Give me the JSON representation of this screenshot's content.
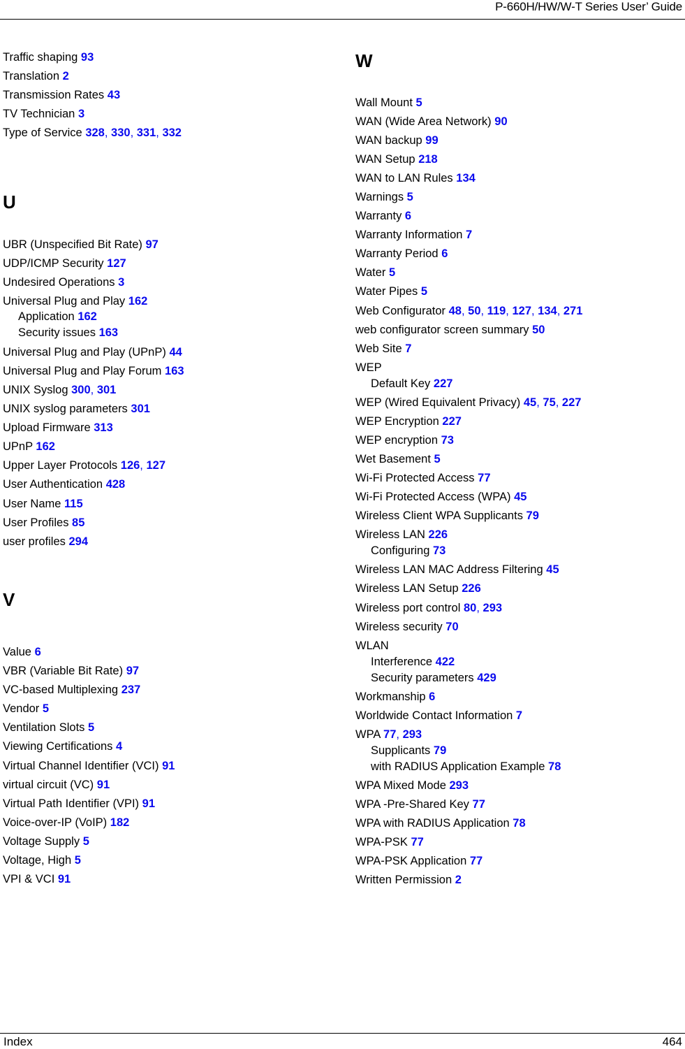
{
  "header": {
    "title": "P-660H/HW/W-T Series User’ Guide"
  },
  "footer": {
    "section": "Index",
    "page_number": "464"
  },
  "left_column": [
    {
      "type": "entry",
      "term": "Traffic shaping",
      "pages": [
        "93"
      ]
    },
    {
      "type": "entry",
      "term": "Translation",
      "pages": [
        "2"
      ]
    },
    {
      "type": "entry",
      "term": "Transmission Rates",
      "pages": [
        "43"
      ]
    },
    {
      "type": "entry",
      "term": "TV Technician",
      "pages": [
        "3"
      ]
    },
    {
      "type": "entry",
      "term": "Type of Service",
      "pages": [
        "328",
        "330",
        "331",
        "332"
      ]
    },
    {
      "type": "letter",
      "term": "U"
    },
    {
      "type": "entry",
      "term": "UBR (Unspecified Bit Rate)",
      "pages": [
        "97"
      ]
    },
    {
      "type": "entry",
      "term": "UDP/ICMP Security",
      "pages": [
        "127"
      ]
    },
    {
      "type": "entry",
      "term": "Undesired Operations",
      "pages": [
        "3"
      ]
    },
    {
      "type": "entry",
      "term": "Universal Plug and Play",
      "pages": [
        "162"
      ]
    },
    {
      "type": "sub",
      "term": "Application",
      "pages": [
        "162"
      ]
    },
    {
      "type": "sub",
      "term": "Security issues",
      "pages": [
        "163"
      ]
    },
    {
      "type": "entry",
      "term": "Universal Plug and Play (UPnP)",
      "pages": [
        "44"
      ]
    },
    {
      "type": "entry",
      "term": "Universal Plug and Play Forum",
      "pages": [
        "163"
      ]
    },
    {
      "type": "entry",
      "term": "UNIX Syslog",
      "pages": [
        "300",
        "301"
      ]
    },
    {
      "type": "entry",
      "term": "UNIX syslog parameters",
      "pages": [
        "301"
      ]
    },
    {
      "type": "entry",
      "term": "Upload Firmware",
      "pages": [
        "313"
      ]
    },
    {
      "type": "entry",
      "term": "UPnP",
      "pages": [
        "162"
      ]
    },
    {
      "type": "entry",
      "term": "Upper Layer Protocols",
      "pages": [
        "126",
        "127"
      ]
    },
    {
      "type": "entry",
      "term": "User Authentication",
      "pages": [
        "428"
      ]
    },
    {
      "type": "entry",
      "term": "User Name",
      "pages": [
        "115"
      ]
    },
    {
      "type": "entry",
      "term": "User Profiles",
      "pages": [
        "85"
      ]
    },
    {
      "type": "entry",
      "term": "user profiles",
      "pages": [
        "294"
      ]
    },
    {
      "type": "letter",
      "term": "V"
    },
    {
      "type": "entry",
      "term": "Value",
      "pages": [
        "6"
      ]
    },
    {
      "type": "entry",
      "term": "VBR (Variable Bit Rate)",
      "pages": [
        "97"
      ]
    },
    {
      "type": "entry",
      "term": "VC-based Multiplexing",
      "pages": [
        "237"
      ]
    },
    {
      "type": "entry",
      "term": "Vendor",
      "pages": [
        "5"
      ]
    },
    {
      "type": "entry",
      "term": "Ventilation Slots",
      "pages": [
        "5"
      ]
    },
    {
      "type": "entry",
      "term": "Viewing Certifications",
      "pages": [
        "4"
      ]
    },
    {
      "type": "entry",
      "term": "Virtual Channel Identifier (VCI)",
      "pages": [
        "91"
      ]
    },
    {
      "type": "entry",
      "term": "virtual circuit (VC)",
      "pages": [
        "91"
      ]
    },
    {
      "type": "entry",
      "term": "Virtual Path Identifier (VPI)",
      "pages": [
        "91"
      ]
    },
    {
      "type": "entry",
      "term": "Voice-over-IP (VoIP)",
      "pages": [
        "182"
      ]
    },
    {
      "type": "entry",
      "term": "Voltage Supply",
      "pages": [
        "5"
      ]
    },
    {
      "type": "entry",
      "term": "Voltage, High",
      "pages": [
        "5"
      ]
    },
    {
      "type": "entry",
      "term": "VPI & VCI",
      "pages": [
        "91"
      ]
    }
  ],
  "right_column": [
    {
      "type": "letter",
      "term": "W"
    },
    {
      "type": "entry",
      "term": "Wall Mount",
      "pages": [
        "5"
      ]
    },
    {
      "type": "entry",
      "term": "WAN (Wide Area Network)",
      "pages": [
        "90"
      ]
    },
    {
      "type": "entry",
      "term": "WAN backup",
      "pages": [
        "99"
      ]
    },
    {
      "type": "entry",
      "term": "WAN Setup",
      "pages": [
        "218"
      ]
    },
    {
      "type": "entry",
      "term": "WAN to LAN Rules",
      "pages": [
        "134"
      ]
    },
    {
      "type": "entry",
      "term": "Warnings",
      "pages": [
        "5"
      ]
    },
    {
      "type": "entry",
      "term": "Warranty",
      "pages": [
        "6"
      ]
    },
    {
      "type": "entry",
      "term": "Warranty Information",
      "pages": [
        "7"
      ]
    },
    {
      "type": "entry",
      "term": "Warranty Period",
      "pages": [
        "6"
      ]
    },
    {
      "type": "entry",
      "term": "Water",
      "pages": [
        "5"
      ]
    },
    {
      "type": "entry",
      "term": "Water Pipes",
      "pages": [
        "5"
      ]
    },
    {
      "type": "entry",
      "term": "Web Configurator",
      "pages": [
        "48",
        "50",
        "119",
        "127",
        "134",
        "271"
      ]
    },
    {
      "type": "entry",
      "term": "web configurator screen summary",
      "pages": [
        "50"
      ]
    },
    {
      "type": "entry",
      "term": "Web Site",
      "pages": [
        "7"
      ]
    },
    {
      "type": "entry",
      "term": "WEP",
      "pages": []
    },
    {
      "type": "sub",
      "term": "Default Key",
      "pages": [
        "227"
      ]
    },
    {
      "type": "entry",
      "term": "WEP (Wired Equivalent Privacy)",
      "pages": [
        "45",
        "75",
        "227"
      ]
    },
    {
      "type": "entry",
      "term": "WEP Encryption",
      "pages": [
        "227"
      ]
    },
    {
      "type": "entry",
      "term": "WEP encryption",
      "pages": [
        "73"
      ]
    },
    {
      "type": "entry",
      "term": "Wet Basement",
      "pages": [
        "5"
      ]
    },
    {
      "type": "entry",
      "term": "Wi-Fi Protected Access",
      "pages": [
        "77"
      ]
    },
    {
      "type": "entry",
      "term": "Wi-Fi Protected Access (WPA)",
      "pages": [
        "45"
      ]
    },
    {
      "type": "entry",
      "term": "Wireless Client WPA Supplicants",
      "pages": [
        "79"
      ]
    },
    {
      "type": "entry",
      "term": "Wireless LAN",
      "pages": [
        "226"
      ]
    },
    {
      "type": "sub",
      "term": "Configuring",
      "pages": [
        "73"
      ]
    },
    {
      "type": "entry",
      "term": "Wireless LAN MAC Address Filtering",
      "pages": [
        "45"
      ]
    },
    {
      "type": "entry",
      "term": "Wireless LAN Setup",
      "pages": [
        "226"
      ]
    },
    {
      "type": "entry",
      "term": "Wireless port control",
      "pages": [
        "80",
        "293"
      ]
    },
    {
      "type": "entry",
      "term": "Wireless security",
      "pages": [
        "70"
      ]
    },
    {
      "type": "entry",
      "term": "WLAN",
      "pages": []
    },
    {
      "type": "sub",
      "term": "Interference",
      "pages": [
        "422"
      ]
    },
    {
      "type": "sub",
      "term": "Security parameters",
      "pages": [
        "429"
      ]
    },
    {
      "type": "entry",
      "term": "Workmanship",
      "pages": [
        "6"
      ]
    },
    {
      "type": "entry",
      "term": "Worldwide Contact Information",
      "pages": [
        "7"
      ]
    },
    {
      "type": "entry",
      "term": "WPA",
      "pages": [
        "77",
        "293"
      ]
    },
    {
      "type": "sub",
      "term": "Supplicants",
      "pages": [
        "79"
      ]
    },
    {
      "type": "sub",
      "term": "with RADIUS Application Example",
      "pages": [
        "78"
      ]
    },
    {
      "type": "entry",
      "term": "WPA Mixed Mode",
      "pages": [
        "293"
      ]
    },
    {
      "type": "entry",
      "term": "WPA -Pre-Shared Key",
      "pages": [
        "77"
      ]
    },
    {
      "type": "entry",
      "term": "WPA with RADIUS Application",
      "pages": [
        "78"
      ]
    },
    {
      "type": "entry",
      "term": "WPA-PSK",
      "pages": [
        "77"
      ]
    },
    {
      "type": "entry",
      "term": "WPA-PSK Application",
      "pages": [
        "77"
      ]
    },
    {
      "type": "entry",
      "term": "Written Permission",
      "pages": [
        "2"
      ]
    }
  ]
}
